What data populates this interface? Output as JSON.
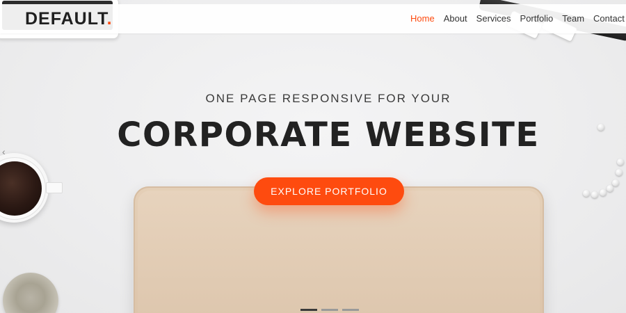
{
  "brand": {
    "name": "DEFAULT",
    "dot": "."
  },
  "nav": {
    "items": [
      "Home",
      "About",
      "Services",
      "Portfolio",
      "Team",
      "Contact"
    ],
    "active_index": 0
  },
  "hero": {
    "subtitle": "ONE PAGE RESPONSIVE FOR YOUR",
    "title": "CORPORATE WEBSITE",
    "cta_label": "EXPLORE PORTFOLIO",
    "prev_arrow": "‹"
  },
  "slider": {
    "slide_count": 3,
    "active_slide": 1
  },
  "colors": {
    "accent": "#fe4b0f",
    "text_dark": "#222222",
    "background": "#efefef"
  },
  "icons": {
    "prev": "chevron-left-icon"
  }
}
